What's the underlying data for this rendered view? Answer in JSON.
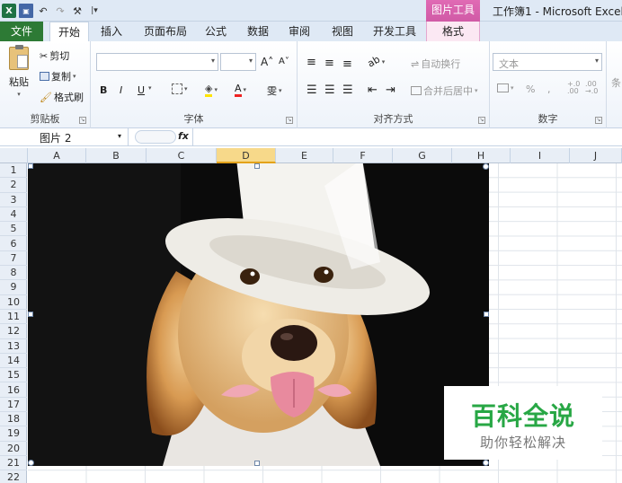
{
  "window": {
    "title": "工作簿1 - Microsoft Excel",
    "context_tab_group": "图片工具",
    "app_icon": "excel-icon"
  },
  "qat": {
    "app_glyph": "X",
    "save": "save-icon",
    "undo_glyph": "↶",
    "redo_glyph": "↷",
    "tool_glyph": "⚒",
    "customize_glyph": "|▾"
  },
  "tabs": [
    {
      "label": "文件"
    },
    {
      "label": "开始"
    },
    {
      "label": "插入"
    },
    {
      "label": "页面布局"
    },
    {
      "label": "公式"
    },
    {
      "label": "数据"
    },
    {
      "label": "审阅"
    },
    {
      "label": "视图"
    },
    {
      "label": "开发工具"
    },
    {
      "label": "格式"
    }
  ],
  "ribbon": {
    "clipboard": {
      "label": "剪贴板",
      "paste": "粘贴",
      "cut": "剪切",
      "copy": "复制",
      "format_painter": "格式刷"
    },
    "font": {
      "label": "字体",
      "font_name": "",
      "font_size": "",
      "grow": "A˄",
      "shrink": "A˅",
      "bold": "B",
      "italic": "I",
      "underline": "U",
      "font_color": "A",
      "phonetic": "雯"
    },
    "alignment": {
      "label": "对齐方式",
      "wrap_text": "自动换行",
      "merge_center": "合并后居中"
    },
    "number": {
      "label": "数字",
      "format": "文本",
      "percent": "%",
      "comma": ",",
      "inc_decimal": "+.0\n.00",
      "dec_decimal": ".00\n→.0"
    },
    "styles_partial": "条"
  },
  "formula_bar": {
    "name_box": "图片 2",
    "fx": "fx",
    "formula": ""
  },
  "columns": [
    "A",
    "B",
    "C",
    "D",
    "E",
    "F",
    "G",
    "H",
    "I",
    "J"
  ],
  "active_column": "D",
  "rows": [
    "1",
    "2",
    "3",
    "4",
    "5",
    "6",
    "7",
    "8",
    "9",
    "10",
    "11",
    "12",
    "13",
    "14",
    "15",
    "16",
    "17",
    "18",
    "19",
    "20",
    "21",
    "22"
  ],
  "picture": {
    "name": "图片 2",
    "subject": "dog-in-white-hat-photo"
  },
  "watermark": {
    "title": "百科全说",
    "subtitle": "助你轻松解决"
  },
  "colors": {
    "file_tab": "#2d7a35",
    "context_tab": "#d05aa6",
    "ribbon_bg": "#eef3fa",
    "active_header": "#f7d98a",
    "watermark_green": "#28a745"
  }
}
